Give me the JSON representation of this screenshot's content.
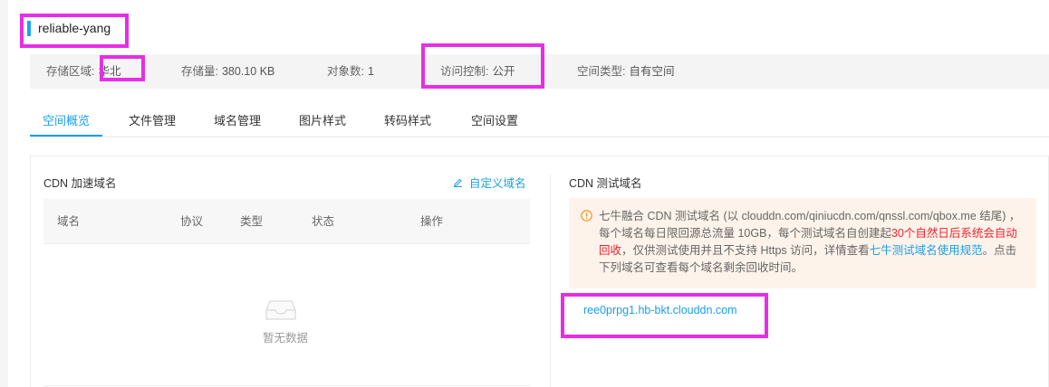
{
  "bucket": {
    "name": "reliable-yang"
  },
  "info": {
    "region_label": "存储区域:",
    "region_value": "华北",
    "storage_label": "存储量:",
    "storage_value": "380.10 KB",
    "objects_label": "对象数:",
    "objects_value": "1",
    "access_label": "访问控制:",
    "access_value": "公开",
    "type_label": "空间类型:",
    "type_value": "自有空间"
  },
  "tabs": [
    "空间概览",
    "文件管理",
    "域名管理",
    "图片样式",
    "转码样式",
    "空间设置"
  ],
  "cdn": {
    "title": "CDN 加速域名",
    "custom_link": "自定义域名",
    "columns": [
      "域名",
      "协议",
      "类型",
      "状态",
      "操作"
    ],
    "empty_text": "暂无数据"
  },
  "test": {
    "title": "CDN 测试域名",
    "notice_part1": "七牛融合 CDN 测试域名 (以 clouddn.com/qiniucdn.com/qnssl.com/qbox.me 结尾) ，每个域名每日限回源总流量 10GB，每个测试域名自创建起",
    "notice_red": "30个自然日后系统会自动回收",
    "notice_part2": "，仅供测试使用并且不支持 Https 访问，详情查看",
    "notice_link": "七牛测试域名使用规范",
    "notice_part3": "。点击下列域名可查看每个域名剩余回收时间。",
    "domain": "ree0prpg1.hb-bkt.clouddn.com"
  },
  "colors": {
    "accent": "#1a9fe8",
    "highlight": "#e62ee6",
    "warning_bg": "#fdf3ea",
    "danger": "#f5222d"
  }
}
